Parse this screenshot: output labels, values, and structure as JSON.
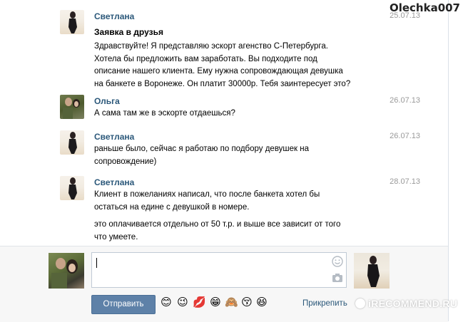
{
  "watermark_top": "Olechka007",
  "messages": [
    {
      "author": "Светлана",
      "date": "25.07.13",
      "subject": "Заявка в друзья",
      "paragraphs": [
        "Здравствуйте! Я представляю эскорт агенство С-Петербурга. Хотела бы предложить вам заработать. Вы подходите под описание нашего клиента. Ему нужна сопровождающая девушка на банкете в Воронеже. Он платит 30000р. Тебя заинтересует это?"
      ]
    },
    {
      "author": "Ольга",
      "date": "26.07.13",
      "paragraphs": [
        "А сама там же в эскорте отдаешься?"
      ]
    },
    {
      "author": "Светлана",
      "date": "26.07.13",
      "paragraphs": [
        "раньше было, сейчас я работаю по подбору девушек на сопровождение)"
      ]
    },
    {
      "author": "Светлана",
      "date": "28.07.13",
      "paragraphs": [
        "Клиент в пожеланиях написал, что после банкета хотел бы остаться на едине с девушкой в номере.",
        "это оплачивается отдельно от 50 т.р. и выше все зависит от того что умеете."
      ]
    }
  ],
  "composer": {
    "input_value": "",
    "send_label": "Отправить",
    "attach_label": "Прикрепить",
    "emojis": [
      "😊",
      "😉",
      "💋",
      "😁",
      "🙈",
      "😚",
      "😆"
    ]
  },
  "watermark_bottom": "iRECOMMEND.RU",
  "colors": {
    "author": "#2b587a",
    "date": "#999999",
    "send_button": "#5e81a8",
    "composer_bg": "#f7f7f7"
  }
}
